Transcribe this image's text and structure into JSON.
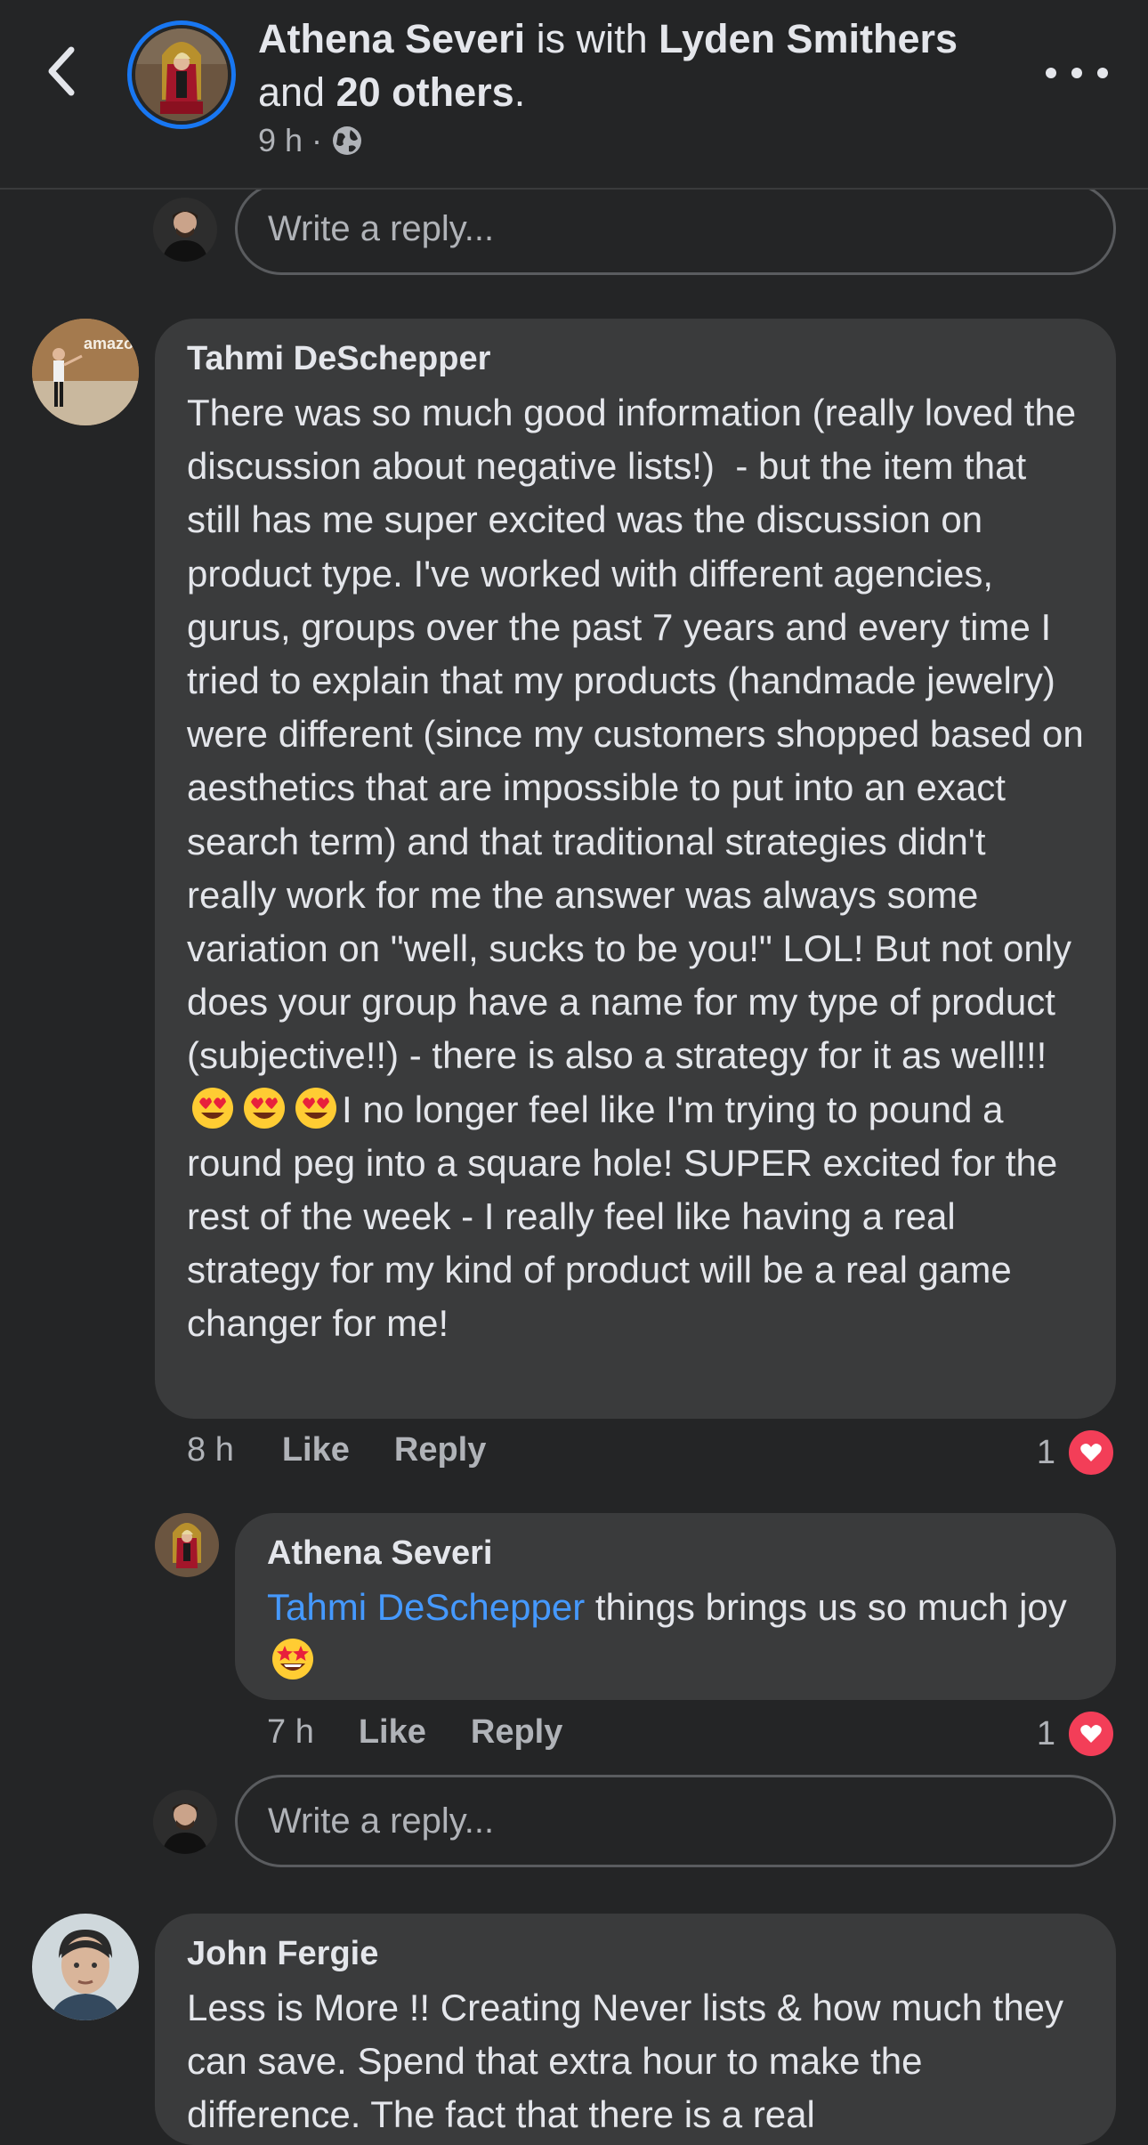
{
  "header": {
    "author": "Athena Severi",
    "with_text": " is with ",
    "tagged": "Lyden Smithers",
    "and_text": "and ",
    "others": "20 others",
    "period": ".",
    "time": "9 h",
    "separator": "·",
    "privacy_icon": "globe-icon",
    "back_icon": "chevron-left-icon",
    "more_icon": "more-horizontal-icon"
  },
  "reply_box": {
    "placeholder": "Write a reply..."
  },
  "comments": [
    {
      "author": "Tahmi DeSchepper",
      "avatar_logo_text": "amazon",
      "text_part1": "There was so much good information (really loved the discussion about negative lists!)  - but the item that still has me super excited was the discussion on product type. I've worked with different agencies, gurus, groups over the past 7 years and every time I tried to explain that my products (handmade jewelry) were different (since my customers shopped based on aesthetics that are impossible to put into an exact search term) and that traditional strategies didn't really work for me the answer was always some variation on \"well, sucks to be you!\" LOL! But not only does your group have a name for my type of product (subjective!!) - there is also a strategy for it as well!!! ",
      "emojis": [
        "heart-eyes-emoji",
        "heart-eyes-emoji",
        "heart-eyes-emoji"
      ],
      "text_part2": "I no longer feel like I'm trying to pound a round peg into a square hole! SUPER excited for the rest of the week - I really feel like having a real strategy for my kind of product will be a real game changer for me!",
      "time": "8 h",
      "like_label": "Like",
      "reply_label": "Reply",
      "reaction_count": "1",
      "reaction_icon": "heart-reaction-icon"
    },
    {
      "author": "Athena Severi",
      "mention": "Tahmi DeSchepper",
      "text": " things brings us so much joy ",
      "emoji": "star-struck-emoji",
      "time": "7 h",
      "like_label": "Like",
      "reply_label": "Reply",
      "reaction_count": "1",
      "reaction_icon": "heart-reaction-icon"
    },
    {
      "author": "John Fergie",
      "text": "Less is More !! Creating Never lists & how much they can save. Spend that extra hour to make the difference. The fact that there is a real"
    }
  ],
  "colors": {
    "background": "#242526",
    "bubble": "#3a3b3c",
    "text_primary": "#e4e6eb",
    "text_secondary": "#b0b3b8",
    "mention": "#4599ff",
    "story_ring": "#1877f2",
    "heart": "#f33e58"
  }
}
